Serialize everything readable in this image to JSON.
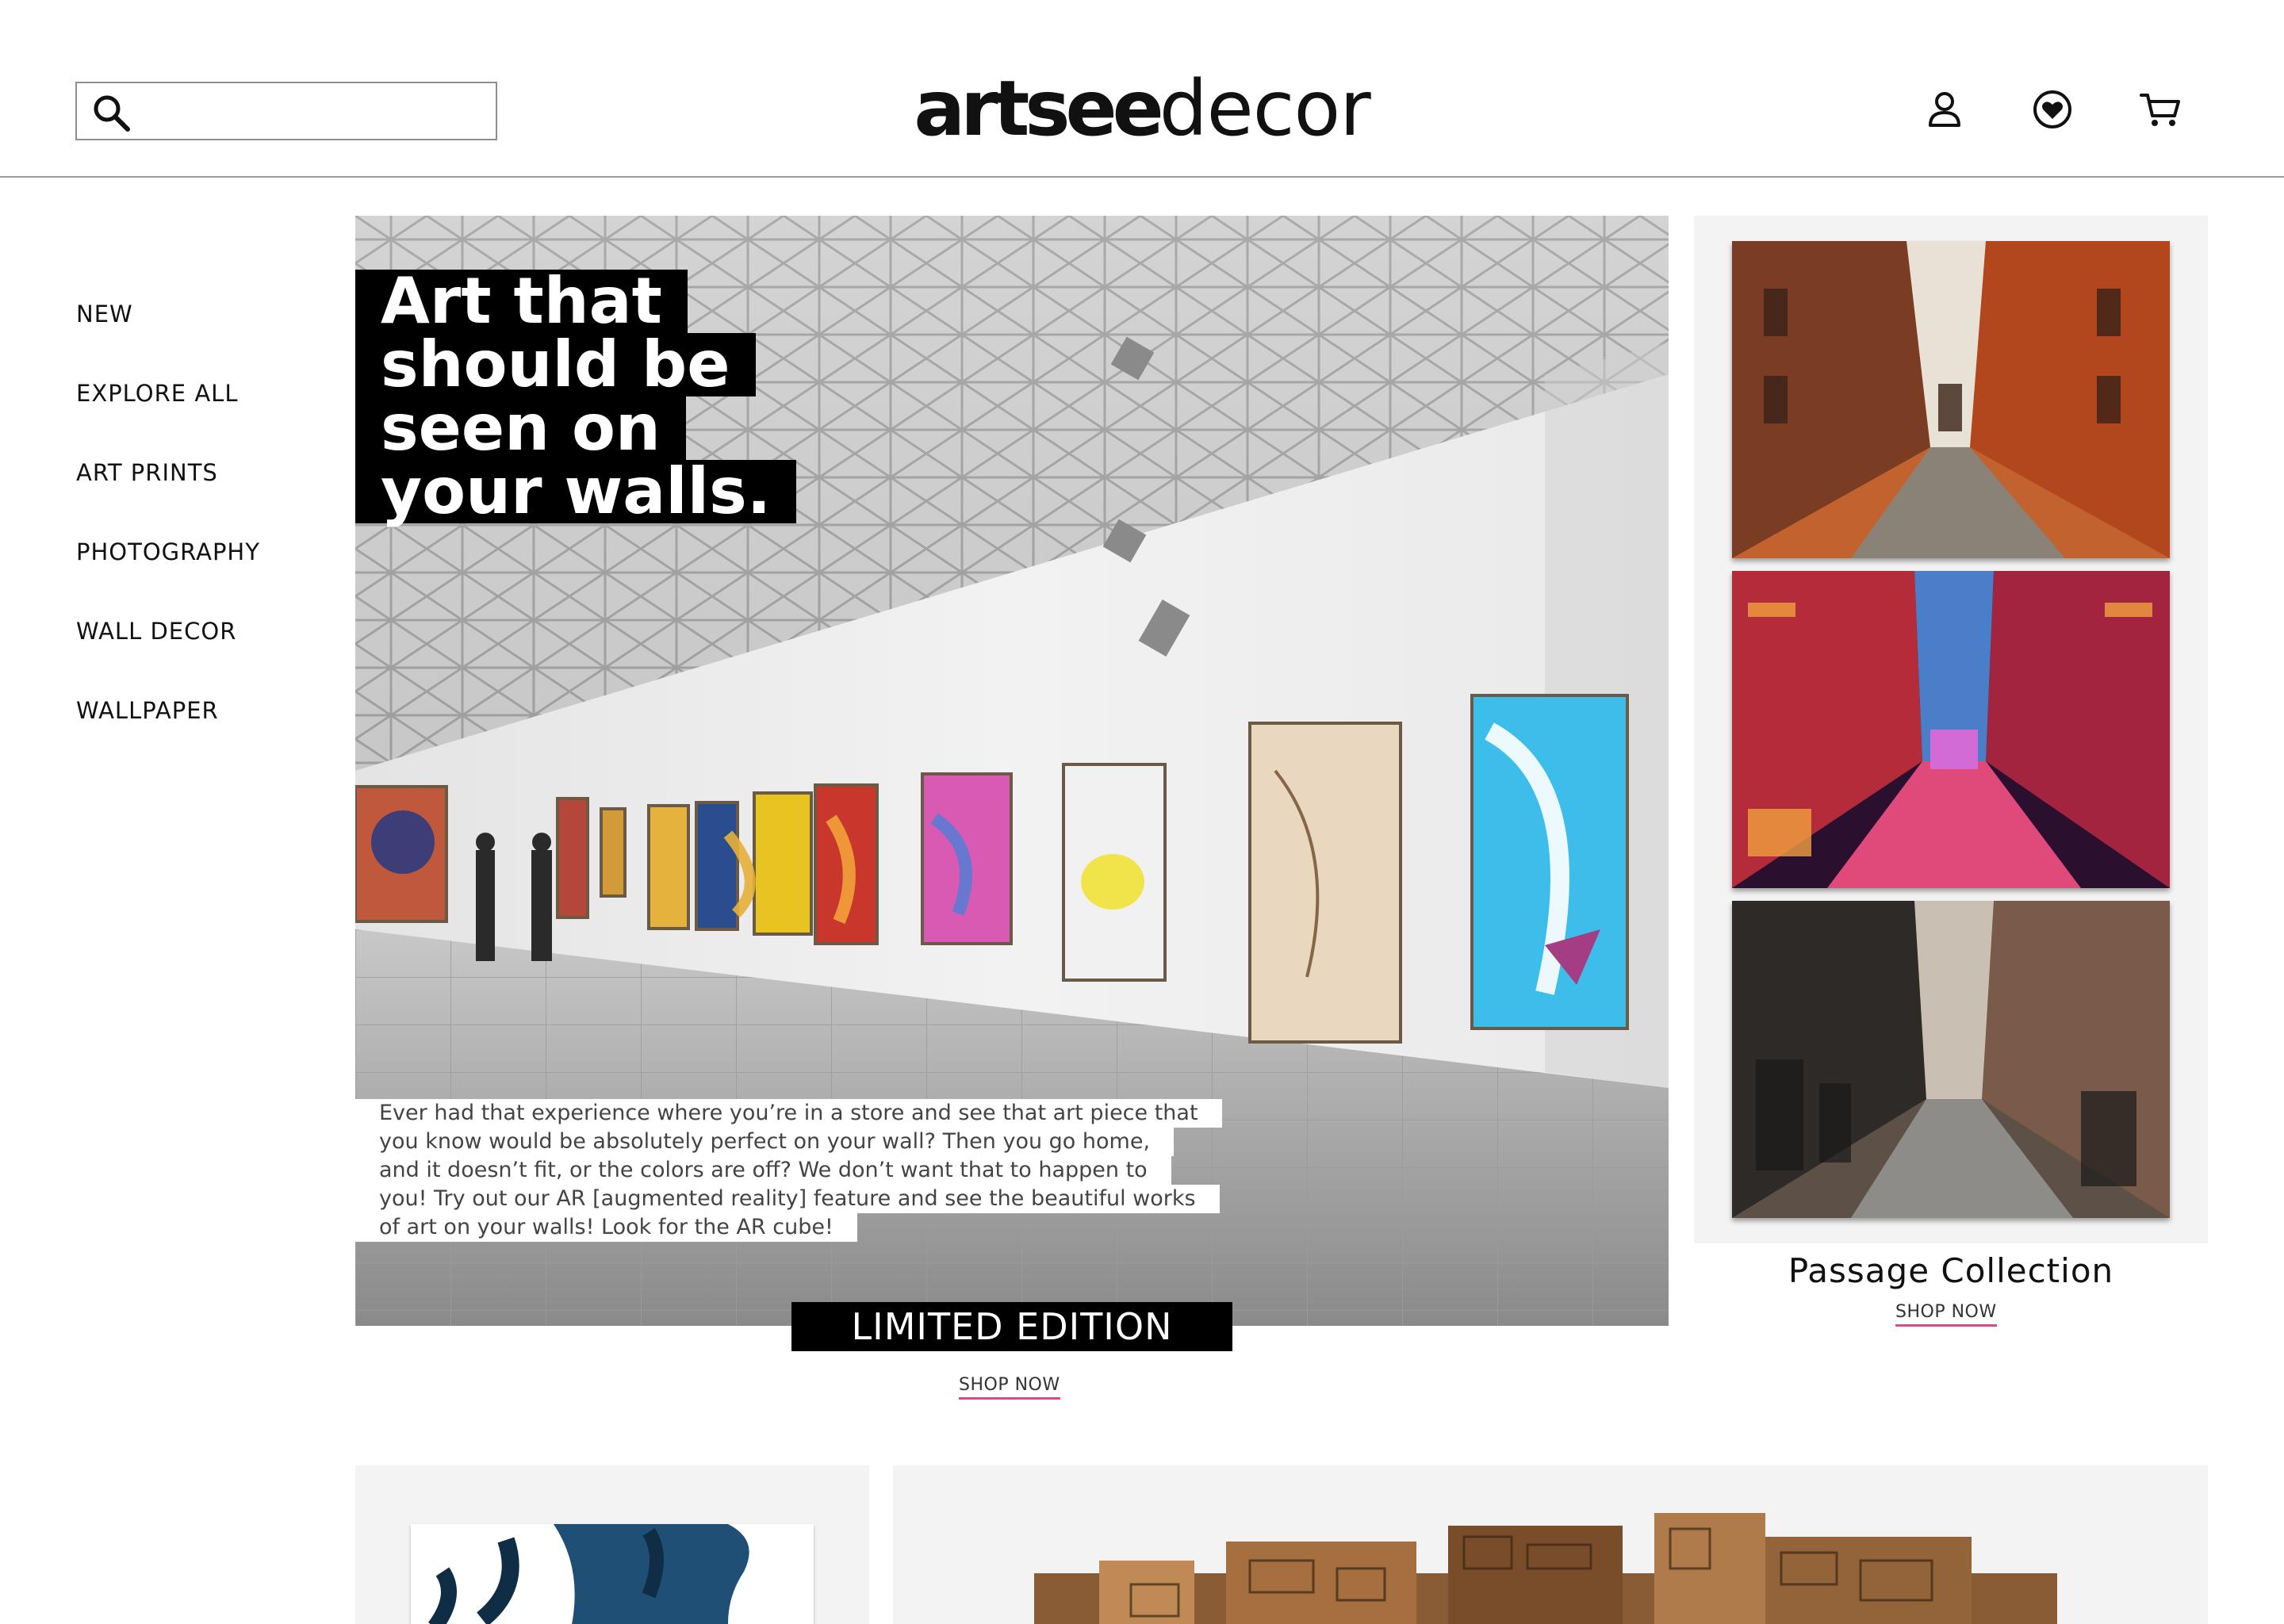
{
  "header": {
    "search": {
      "placeholder": "",
      "value": ""
    },
    "logo": {
      "bold": "artsee",
      "light": "decor"
    },
    "icons": [
      "search-icon",
      "account-icon",
      "wishlist-icon",
      "cart-icon"
    ]
  },
  "sidebar": {
    "items": [
      {
        "label": "NEW"
      },
      {
        "label": "EXPLORE ALL"
      },
      {
        "label": "ART PRINTS"
      },
      {
        "label": "PHOTOGRAPHY"
      },
      {
        "label": "WALL DECOR"
      },
      {
        "label": "WALLPAPER"
      }
    ]
  },
  "hero": {
    "headline": [
      "Art that",
      "should be",
      "seen on",
      "your walls."
    ],
    "copy": [
      "Ever had that experience where you’re in a store and see that art piece that",
      "you know would be absolutely perfect on your wall? Then you go home,",
      "and it doesn’t fit, or the colors are off? We don’t want that to happen to",
      "you! Try out our AR [augmented reality] feature and see the beautiful works",
      "of art on your walls! Look for the AR cube!"
    ],
    "badge": "LIMITED EDITION",
    "shop_label": "SHOP NOW"
  },
  "collection": {
    "title": "Passage Collection",
    "shop_label": "SHOP NOW",
    "thumbs": [
      "alley-orange-photo",
      "alley-neon-photo",
      "alley-brick-photo"
    ]
  },
  "colors": {
    "accent_underline": "#e0488e",
    "panel_bg": "#f3f3f3",
    "black": "#000000"
  }
}
